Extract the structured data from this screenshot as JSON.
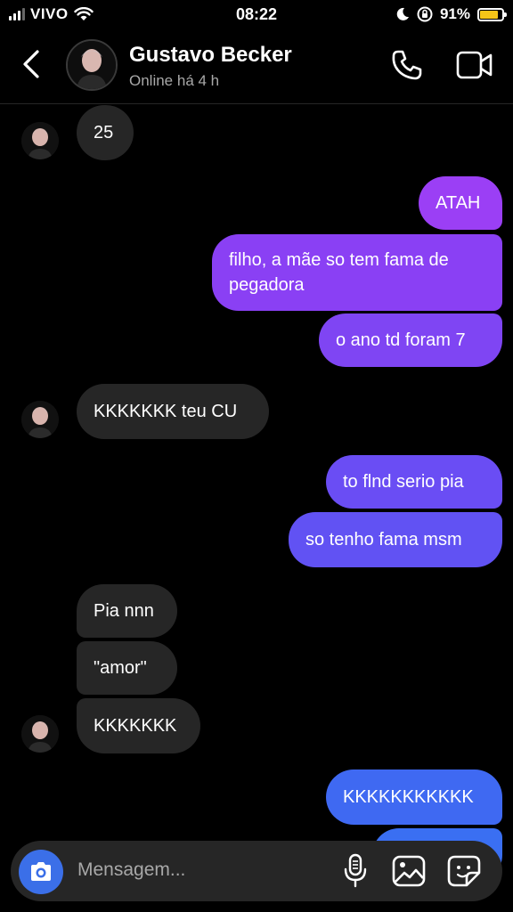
{
  "status_bar": {
    "carrier": "VIVO",
    "time": "08:22",
    "battery_percent": "91%",
    "battery_level": 0.91,
    "battery_color": "#f5c518"
  },
  "header": {
    "back_icon": "chevron-left-icon",
    "contact_name": "Gustavo Becker",
    "contact_status": "Online há 4 h",
    "call_icon": "phone-icon",
    "video_icon": "video-camera-icon"
  },
  "messages": [
    {
      "side": "in",
      "text": "25"
    },
    {
      "side": "out",
      "text": "ATAH"
    },
    {
      "side": "out",
      "text": "filho, a mãe so tem fama de pegadora"
    },
    {
      "side": "out",
      "text": "o ano td foram 7"
    },
    {
      "side": "in",
      "text": "KKKKKKK teu CU"
    },
    {
      "side": "out",
      "text": "to flnd serio pia"
    },
    {
      "side": "out",
      "text": "so tenho fama msm"
    },
    {
      "side": "in",
      "text": "Pia nnn"
    },
    {
      "side": "in",
      "text": "\"amor\""
    },
    {
      "side": "in",
      "text": "KKKKKKK"
    },
    {
      "side": "out",
      "text": "KKKKKKKKKKK"
    }
  ],
  "composer": {
    "placeholder": "Mensagem...",
    "camera_icon": "camera-icon",
    "mic_icon": "microphone-icon",
    "gallery_icon": "image-gallery-icon",
    "sticker_icon": "sticker-icon"
  },
  "colors": {
    "incoming_bubble": "#262626",
    "outgoing_purple": "#8b3ff0",
    "outgoing_blue": "#3c6cf2",
    "camera_button": "#3b6fe8"
  }
}
